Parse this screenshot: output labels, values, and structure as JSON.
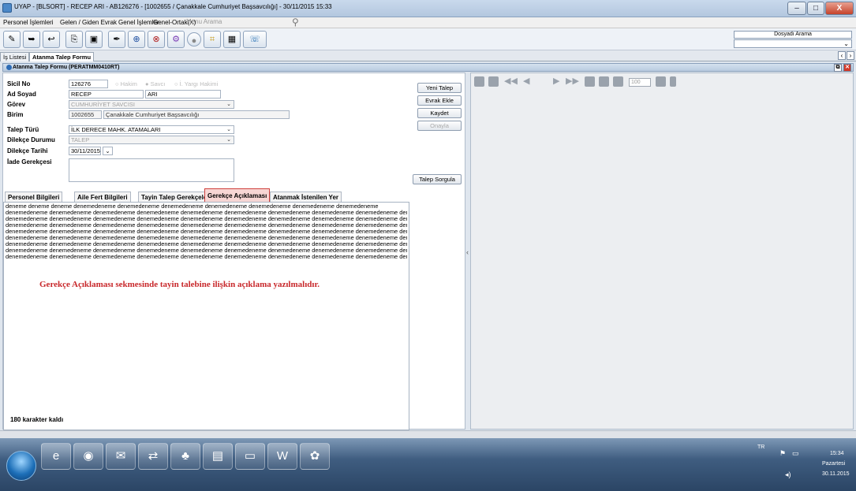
{
  "window": {
    "title": "UYAP - [BLSORT] - RECEP ARI - AB126276 - [1002655 / Çanakkale Cumhuriyet Başsavcılığı] - 30/11/2015 15:33",
    "min": "–",
    "max": "□",
    "close": "X"
  },
  "menu": {
    "items": [
      "Personel İşlemleri",
      "Gelen / Giden Evrak",
      "Genel İşlemler",
      "Genel-Ortak(X)"
    ],
    "search_placeholder": "Menu Arama"
  },
  "toolbar": {
    "icons": [
      "edit-icon",
      "forward-icon",
      "reply-icon",
      "copy-icon",
      "archive-icon",
      "pen-icon",
      "add-doc-icon",
      "remove-doc-icon",
      "settings-icon",
      "record-icon",
      "tools-icon",
      "calc-icon",
      "help-icon"
    ],
    "doc_search_label": "Dosyadı Arama"
  },
  "tabs": {
    "items": [
      "İş Listesi",
      "Atanma Talep Formu"
    ],
    "active": 1
  },
  "form": {
    "header": "Atanma Talep Formu (PERATMM0410RT)",
    "sicil_label": "Sicil No",
    "sicil": "126276",
    "radio_hakim": "Hakim",
    "radio_savci": "Savcı",
    "radio_yargi": "İ. Yargı Hakimi",
    "adsoyad_label": "Ad Soyad",
    "ad": "RECEP",
    "soyad": "ARI",
    "gorev_label": "Görev",
    "gorev": "CUMHURİYET SAVCISI",
    "birim_label": "Birim",
    "birim_kod": "1002655",
    "birim_ad": "Çanakkale Cumhuriyet Başsavcılığı",
    "talep_turu_label": "Talep Türü",
    "talep_turu": "İLK DERECE MAHK. ATAMALARI",
    "dilekce_durumu_label": "Dilekçe Durumu",
    "dilekce_durumu": "TALEP",
    "dilekce_tarihi_label": "Dilekçe Tarihi",
    "dilekce_tarihi": "30/11/2015",
    "iade_label": "İade Gerekçesi"
  },
  "buttons": {
    "yeni": "Yeni Talep",
    "evrak": "Evrak Ekle",
    "kaydet": "Kaydet",
    "onayla": "Onayla",
    "sorgula": "Talep Sorgula"
  },
  "subtabs": [
    "Personel Bilgileri",
    "Aile Fert Bilgileri",
    "Tayin Talep Gerekçeleri",
    "Gerekçe Açıklaması",
    "Atanmak İstenilen Yer"
  ],
  "textarea": {
    "lines": [
      "deneme deneme deneme denemedeneme denemedeneme denemedeneme denemedeneme denemedeneme denemedeneme denemedeneme",
      "denemedeneme denemedeneme denemedeneme denemedeneme denemedeneme denemedeneme denemedeneme denemedeneme denemedeneme denemedeneme",
      "denemedeneme denemedeneme denemedeneme denemedeneme denemedeneme denemedeneme denemedeneme denemedeneme denemedeneme denemedeneme",
      "denemedeneme denemedeneme denemedeneme denemedeneme denemedeneme denemedeneme denemedeneme denemedeneme denemedeneme denemedeneme",
      "denemedeneme denemedeneme denemedeneme denemedeneme denemedeneme denemedeneme denemedeneme denemedeneme denemedeneme denemedeneme",
      "denemedeneme denemedeneme denemedeneme denemedeneme denemedeneme denemedeneme denemedeneme denemedeneme denemedeneme denemedeneme",
      "denemedeneme denemedeneme denemedeneme denemedeneme denemedeneme denemedeneme denemedeneme denemedeneme denemedeneme denemedeneme",
      "denemedeneme denemedeneme denemedeneme denemedeneme denemedeneme denemedeneme denemedeneme denemedeneme denemedeneme denemedeneme",
      "denemedeneme denemedeneme denemedeneme denemedeneme denemedeneme denemedeneme denemedeneme denemedeneme denemedeneme deneme"
    ]
  },
  "annotation": "Gerekçe Açıklaması sekmesinde tayin talebine ilişkin açıklama yazılmalıdır.",
  "char_count": "180 karakter kaldı",
  "viewer": {
    "zoom": "100"
  },
  "tray": {
    "lang": "TR",
    "time": "15:34",
    "day": "Pazartesi",
    "date": "30.11.2015"
  }
}
